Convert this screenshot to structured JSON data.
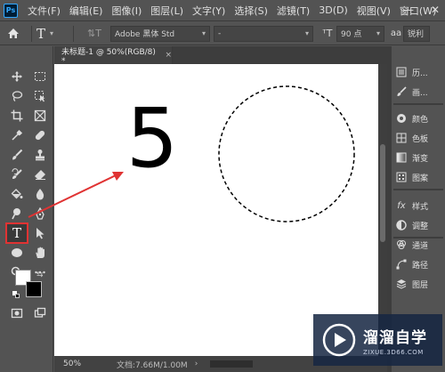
{
  "menubar": {
    "logo": "Ps",
    "items": [
      "文件(F)",
      "编辑(E)",
      "图像(I)",
      "图层(L)",
      "文字(Y)",
      "选择(S)",
      "滤镜(T)",
      "3D(D)",
      "视图(V)",
      "窗口(W)"
    ],
    "minimize": "—",
    "maximize": "❐",
    "close": "✕"
  },
  "options": {
    "tool_glyph": "T",
    "font_family": "Adobe 黑体 Std",
    "font_style": "-",
    "font_size": "90 点",
    "antialias": "锐利"
  },
  "document": {
    "tab_title": "未标题-1 @ 50%(RGB/8) *",
    "tab_close": "×",
    "big_text": "5",
    "zoom": "50%",
    "doc_info": "文档:7.66M/1.00M"
  },
  "panel": {
    "items": [
      "历...",
      "画...",
      "颜色",
      "色板",
      "渐变",
      "图案",
      "样式",
      "调整",
      "通道",
      "路径",
      "图层"
    ]
  },
  "watermark": {
    "name": "溜溜自学",
    "url": "ZIXUE.3D66.COM"
  },
  "colors": {
    "accent_red": "#e03333",
    "foreground": "#ffffff",
    "background": "#000000"
  }
}
